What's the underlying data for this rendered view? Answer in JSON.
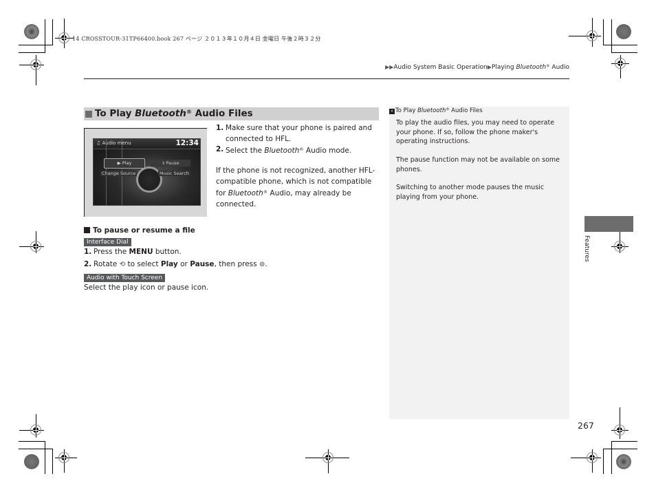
{
  "print_slug": "14 CROSSTOUR-31TP66400.book  267 ページ  ２０１３年１０月４日  金曜日  午後２時３２分",
  "breadcrumb": {
    "items": [
      "Audio System Basic Operation",
      "Playing "
    ],
    "italic": "Bluetooth",
    "reg": "®",
    "tail": " Audio"
  },
  "section": {
    "title_pre": "To Play ",
    "title_italic": "Bluetooth",
    "reg": "®",
    "title_post": " Audio Files"
  },
  "figure": {
    "header_icon": "music-note-icon",
    "header_title": "Audio menu",
    "clock": "12:34",
    "play_label": "▶ Play",
    "pause_label": "॥ Pause",
    "change_source_label": "Change Source",
    "music_search_label": "Music Search"
  },
  "steps": [
    {
      "num": "1.",
      "text": "Make sure that your phone is paired and connected to HFL."
    },
    {
      "num": "2.",
      "pre": "Select the ",
      "italic": "Bluetooth",
      "reg": "®",
      "post": " Audio mode."
    }
  ],
  "note": {
    "pre": "If the phone is not recognized, another HFL-compatible phone, which is not compatible for ",
    "italic": "Bluetooth",
    "reg": "®",
    "post": " Audio, may already be connected."
  },
  "pause_section": {
    "title": "To pause or resume a file",
    "tag_dial": "Interface Dial",
    "step1_num": "1.",
    "step1_pre": "Press the ",
    "step1_bold": "MENU",
    "step1_post": " button.",
    "step2_num": "2.",
    "step2_a": "Rotate ",
    "rotate_icon": "rotate-dial-icon",
    "step2_b": " to select ",
    "step2_play": "Play",
    "step2_or": " or ",
    "step2_pause": "Pause",
    "step2_c": ", then press ",
    "press_icon": "press-dial-icon",
    "step2_end": ".",
    "tag_touch": "Audio with Touch Screen",
    "touch_text": "Select the play icon or pause icon."
  },
  "side_panel": {
    "title_pre": "To Play ",
    "title_italic": "Bluetooth",
    "reg": "®",
    "title_post": " Audio Files",
    "paragraphs": [
      "To play the audio files, you may need to operate your phone. If so, follow the phone maker's operating instructions.",
      "The pause function may not be available on some phones.",
      "Switching to another mode pauses the music playing from your phone."
    ]
  },
  "side_tab": {
    "label": "Features"
  },
  "page_number": "267"
}
